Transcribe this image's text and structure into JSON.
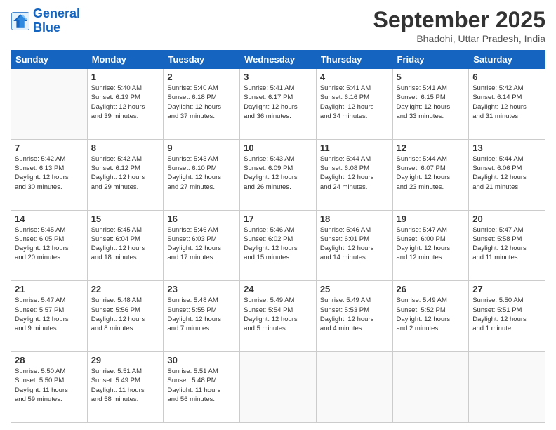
{
  "header": {
    "logo_line1": "General",
    "logo_line2": "Blue",
    "month": "September 2025",
    "location": "Bhadohi, Uttar Pradesh, India"
  },
  "weekdays": [
    "Sunday",
    "Monday",
    "Tuesday",
    "Wednesday",
    "Thursday",
    "Friday",
    "Saturday"
  ],
  "weeks": [
    [
      {
        "day": "",
        "info": ""
      },
      {
        "day": "1",
        "info": "Sunrise: 5:40 AM\nSunset: 6:19 PM\nDaylight: 12 hours\nand 39 minutes."
      },
      {
        "day": "2",
        "info": "Sunrise: 5:40 AM\nSunset: 6:18 PM\nDaylight: 12 hours\nand 37 minutes."
      },
      {
        "day": "3",
        "info": "Sunrise: 5:41 AM\nSunset: 6:17 PM\nDaylight: 12 hours\nand 36 minutes."
      },
      {
        "day": "4",
        "info": "Sunrise: 5:41 AM\nSunset: 6:16 PM\nDaylight: 12 hours\nand 34 minutes."
      },
      {
        "day": "5",
        "info": "Sunrise: 5:41 AM\nSunset: 6:15 PM\nDaylight: 12 hours\nand 33 minutes."
      },
      {
        "day": "6",
        "info": "Sunrise: 5:42 AM\nSunset: 6:14 PM\nDaylight: 12 hours\nand 31 minutes."
      }
    ],
    [
      {
        "day": "7",
        "info": "Sunrise: 5:42 AM\nSunset: 6:13 PM\nDaylight: 12 hours\nand 30 minutes."
      },
      {
        "day": "8",
        "info": "Sunrise: 5:42 AM\nSunset: 6:12 PM\nDaylight: 12 hours\nand 29 minutes."
      },
      {
        "day": "9",
        "info": "Sunrise: 5:43 AM\nSunset: 6:10 PM\nDaylight: 12 hours\nand 27 minutes."
      },
      {
        "day": "10",
        "info": "Sunrise: 5:43 AM\nSunset: 6:09 PM\nDaylight: 12 hours\nand 26 minutes."
      },
      {
        "day": "11",
        "info": "Sunrise: 5:44 AM\nSunset: 6:08 PM\nDaylight: 12 hours\nand 24 minutes."
      },
      {
        "day": "12",
        "info": "Sunrise: 5:44 AM\nSunset: 6:07 PM\nDaylight: 12 hours\nand 23 minutes."
      },
      {
        "day": "13",
        "info": "Sunrise: 5:44 AM\nSunset: 6:06 PM\nDaylight: 12 hours\nand 21 minutes."
      }
    ],
    [
      {
        "day": "14",
        "info": "Sunrise: 5:45 AM\nSunset: 6:05 PM\nDaylight: 12 hours\nand 20 minutes."
      },
      {
        "day": "15",
        "info": "Sunrise: 5:45 AM\nSunset: 6:04 PM\nDaylight: 12 hours\nand 18 minutes."
      },
      {
        "day": "16",
        "info": "Sunrise: 5:46 AM\nSunset: 6:03 PM\nDaylight: 12 hours\nand 17 minutes."
      },
      {
        "day": "17",
        "info": "Sunrise: 5:46 AM\nSunset: 6:02 PM\nDaylight: 12 hours\nand 15 minutes."
      },
      {
        "day": "18",
        "info": "Sunrise: 5:46 AM\nSunset: 6:01 PM\nDaylight: 12 hours\nand 14 minutes."
      },
      {
        "day": "19",
        "info": "Sunrise: 5:47 AM\nSunset: 6:00 PM\nDaylight: 12 hours\nand 12 minutes."
      },
      {
        "day": "20",
        "info": "Sunrise: 5:47 AM\nSunset: 5:58 PM\nDaylight: 12 hours\nand 11 minutes."
      }
    ],
    [
      {
        "day": "21",
        "info": "Sunrise: 5:47 AM\nSunset: 5:57 PM\nDaylight: 12 hours\nand 9 minutes."
      },
      {
        "day": "22",
        "info": "Sunrise: 5:48 AM\nSunset: 5:56 PM\nDaylight: 12 hours\nand 8 minutes."
      },
      {
        "day": "23",
        "info": "Sunrise: 5:48 AM\nSunset: 5:55 PM\nDaylight: 12 hours\nand 7 minutes."
      },
      {
        "day": "24",
        "info": "Sunrise: 5:49 AM\nSunset: 5:54 PM\nDaylight: 12 hours\nand 5 minutes."
      },
      {
        "day": "25",
        "info": "Sunrise: 5:49 AM\nSunset: 5:53 PM\nDaylight: 12 hours\nand 4 minutes."
      },
      {
        "day": "26",
        "info": "Sunrise: 5:49 AM\nSunset: 5:52 PM\nDaylight: 12 hours\nand 2 minutes."
      },
      {
        "day": "27",
        "info": "Sunrise: 5:50 AM\nSunset: 5:51 PM\nDaylight: 12 hours\nand 1 minute."
      }
    ],
    [
      {
        "day": "28",
        "info": "Sunrise: 5:50 AM\nSunset: 5:50 PM\nDaylight: 11 hours\nand 59 minutes."
      },
      {
        "day": "29",
        "info": "Sunrise: 5:51 AM\nSunset: 5:49 PM\nDaylight: 11 hours\nand 58 minutes."
      },
      {
        "day": "30",
        "info": "Sunrise: 5:51 AM\nSunset: 5:48 PM\nDaylight: 11 hours\nand 56 minutes."
      },
      {
        "day": "",
        "info": ""
      },
      {
        "day": "",
        "info": ""
      },
      {
        "day": "",
        "info": ""
      },
      {
        "day": "",
        "info": ""
      }
    ]
  ]
}
